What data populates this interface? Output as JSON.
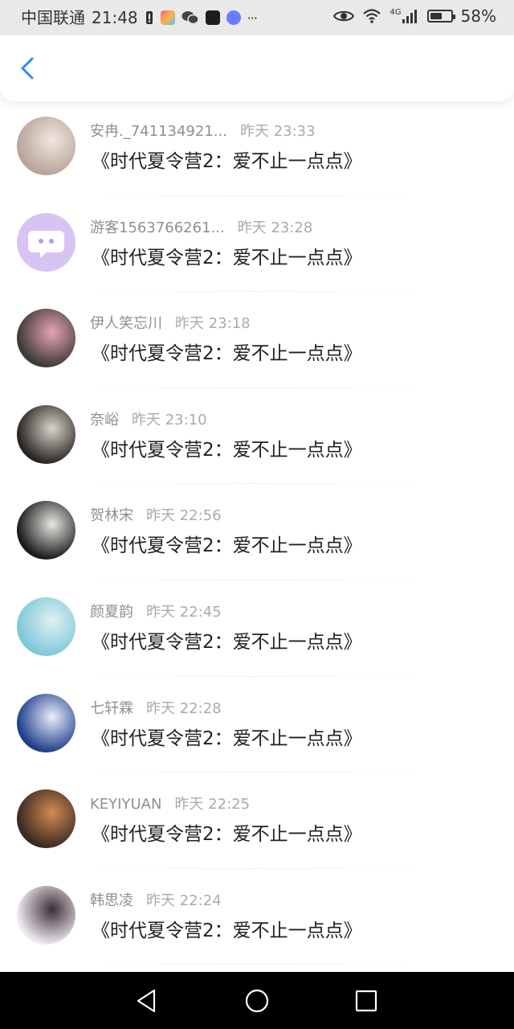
{
  "status_bar": {
    "carrier": "中国联通",
    "time": "21:48",
    "battery_text": "58%",
    "battery_level": 0.58,
    "network": "4G",
    "icons": [
      "alert-icon",
      "app-icon-1",
      "wechat-icon",
      "app-icon-2",
      "app-icon-3",
      "more-dots-icon",
      "eye-icon",
      "wifi-icon",
      "signal-icon",
      "battery-icon"
    ],
    "more": "···"
  },
  "header": {
    "back_icon": "chevron-left-icon",
    "accent_color": "#2d8cf0"
  },
  "items": [
    {
      "name": "安冉._741134921...",
      "time": "昨天 23:33",
      "title": "《时代夏令营2：爱不止一点点》",
      "avatar_colors": [
        "#b9a49a",
        "#f0e6e0"
      ]
    },
    {
      "name": "游客1563766261...",
      "time": "昨天 23:28",
      "title": "《时代夏令营2：爱不止一点点》",
      "avatar_colors": [
        "#d8c4f3",
        "#ffffff"
      ]
    },
    {
      "name": "伊人笑忘川",
      "time": "昨天 23:18",
      "title": "《时代夏令营2：爱不止一点点》",
      "avatar_colors": [
        "#3d3a36",
        "#e7a3b5"
      ]
    },
    {
      "name": "奈峪",
      "time": "昨天 23:10",
      "title": "《时代夏令营2：爱不止一点点》",
      "avatar_colors": [
        "#2a2522",
        "#d9d2cb"
      ]
    },
    {
      "name": "贺林宋",
      "time": "昨天 22:56",
      "title": "《时代夏令营2：爱不止一点点》",
      "avatar_colors": [
        "#1b1b1b",
        "#e8e6e2"
      ]
    },
    {
      "name": "颜夏韵",
      "time": "昨天 22:45",
      "title": "《时代夏令营2：爱不止一点点》",
      "avatar_colors": [
        "#7fc8d8",
        "#dff1f3"
      ]
    },
    {
      "name": "七轩霖",
      "time": "昨天 22:28",
      "title": "《时代夏令营2：爱不止一点点》",
      "avatar_colors": [
        "#1f3f8c",
        "#e9eef9"
      ]
    },
    {
      "name": "KEYIYUAN",
      "time": "昨天 22:25",
      "title": "《时代夏令营2：爱不止一点点》",
      "avatar_colors": [
        "#3a2a22",
        "#d28a52"
      ]
    },
    {
      "name": "韩思凌",
      "time": "昨天 22:24",
      "title": "《时代夏令营2：爱不止一点点》",
      "avatar_colors": [
        "#efe7ef",
        "#3b3037"
      ]
    }
  ],
  "nav_bar": {
    "back": "nav-back-icon",
    "home": "nav-home-icon",
    "recents": "nav-recents-icon"
  }
}
